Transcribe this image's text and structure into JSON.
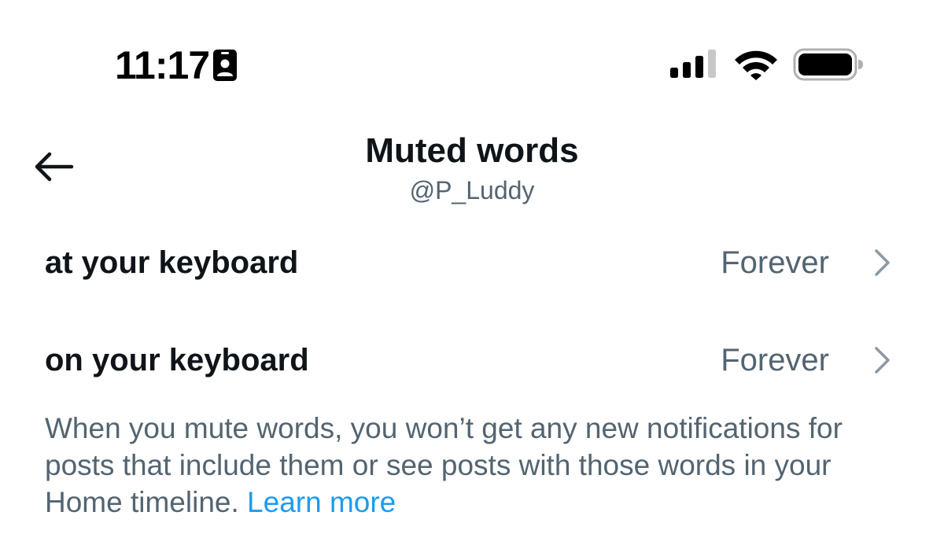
{
  "status_bar": {
    "time": "11:17",
    "icons": [
      "person-badge-icon",
      "cellular-signal-icon",
      "wifi-icon",
      "battery-icon"
    ]
  },
  "header": {
    "back_icon": "arrow-left-icon",
    "title": "Muted words",
    "subtitle": "@P_Luddy"
  },
  "muted_words": [
    {
      "word": "at your keyboard",
      "duration": "Forever",
      "icon": "chevron-right-icon"
    },
    {
      "word": "on your keyboard",
      "duration": "Forever",
      "icon": "chevron-right-icon"
    }
  ],
  "footer": {
    "text": "When you mute words, you won’t get any new notifications for posts that include them or see posts with those words in your Home timeline.",
    "link": "Learn more"
  },
  "colors": {
    "primary_text": "#0f1419",
    "secondary_text": "#536471",
    "link": "#1d9bf0",
    "chevron": "#8b98a5",
    "background": "#ffffff"
  }
}
